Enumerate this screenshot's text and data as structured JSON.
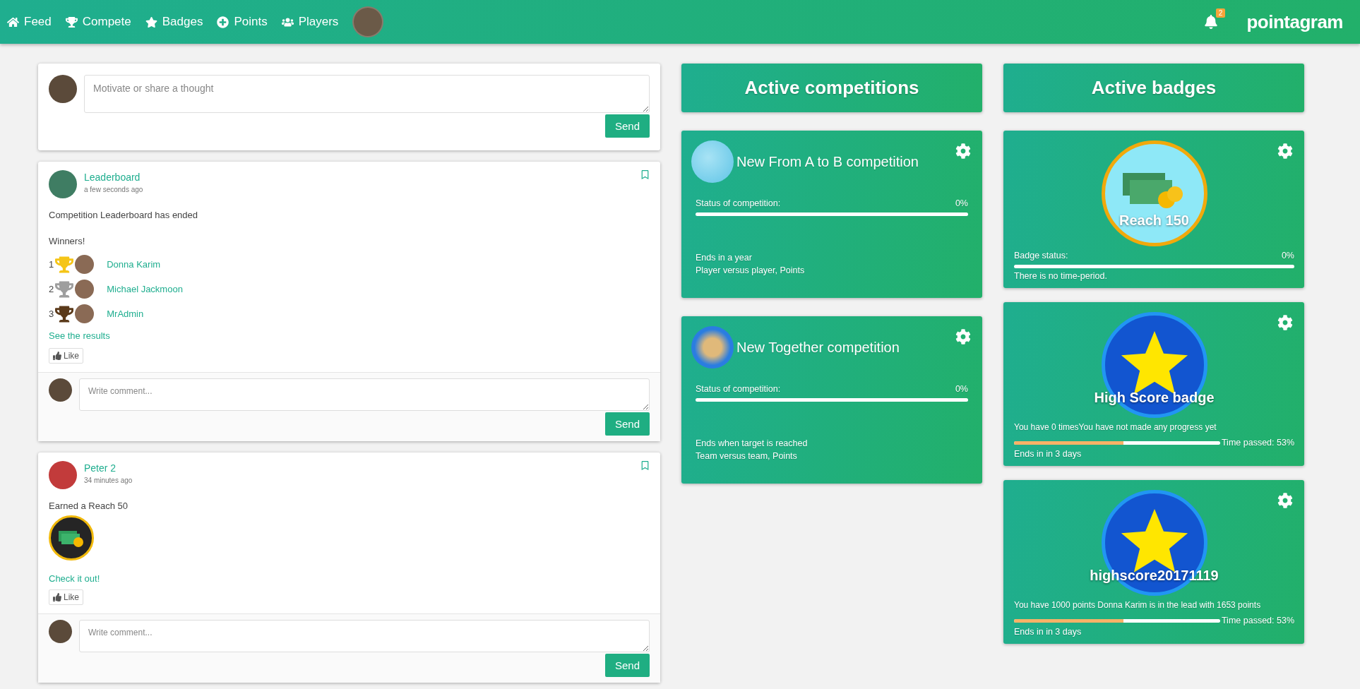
{
  "nav": {
    "items": [
      {
        "label": "Feed"
      },
      {
        "label": "Compete"
      },
      {
        "label": "Badges"
      },
      {
        "label": "Points"
      },
      {
        "label": "Players"
      }
    ],
    "notifications": "2",
    "brand": "pointagram"
  },
  "composer": {
    "placeholder": "Motivate or share a thought",
    "send": "Send"
  },
  "posts": [
    {
      "kind": "competition",
      "author": "Leaderboard",
      "time": "a few seconds ago",
      "text": "Competition Leaderboard has ended",
      "winners_label": "Winners!",
      "winners": [
        {
          "rank": "1",
          "name": "Donna Karim",
          "color": "#f5c518"
        },
        {
          "rank": "2",
          "name": "Michael Jackmoon",
          "color": "#9e9e9e"
        },
        {
          "rank": "3",
          "name": "MrAdmin",
          "color": "#5b3a1a"
        }
      ],
      "link": "See the results",
      "like": "Like",
      "comment_placeholder": "Write comment...",
      "send": "Send"
    },
    {
      "kind": "badge",
      "author": "Peter 2",
      "time": "34 minutes ago",
      "text": "Earned a Reach 50",
      "link": "Check it out!",
      "like": "Like",
      "comment_placeholder": "Write comment...",
      "send": "Send"
    }
  ],
  "competitions": {
    "header": "Active competitions",
    "items": [
      {
        "title": "New From A to B competition",
        "status_label": "Status of competition:",
        "status_value": "0%",
        "level": 0,
        "ends": "Ends in a year",
        "type": "Player versus player, Points"
      },
      {
        "title": "New Together competition",
        "status_label": "Status of competition:",
        "status_value": "0%",
        "level": 0,
        "ends": "Ends when target is reached",
        "type": "Team versus team, Points"
      }
    ]
  },
  "badges": {
    "header": "Active badges",
    "items": [
      {
        "kind": "status",
        "title": "Reach 150",
        "status_label": "Badge status:",
        "status_value": "0%",
        "level": 0,
        "period": "There is no time-period."
      },
      {
        "kind": "timed",
        "title": "High Score badge",
        "progress": "You have 0 timesYou have not made any progress yet",
        "level": 0.53,
        "time_passed": "Time passed: 53%",
        "ends": "Ends in in 3 days"
      },
      {
        "kind": "timed",
        "title": "highscore20171119",
        "progress": "You have 1000 points Donna Karim is in the lead with 1653 points",
        "level": 0.53,
        "time_passed": "Time passed: 53%",
        "ends": "Ends in in 3 days"
      }
    ]
  }
}
